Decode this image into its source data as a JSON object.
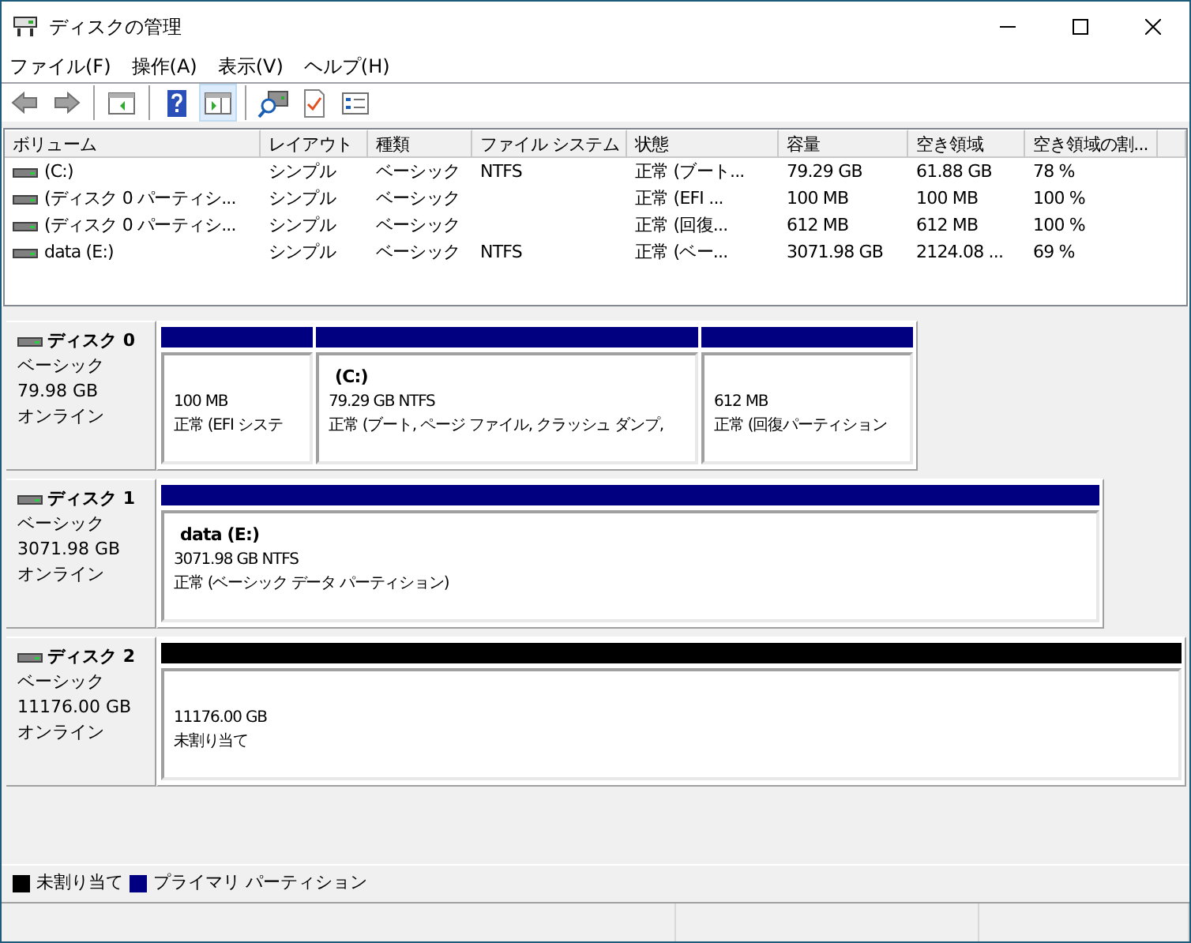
{
  "window": {
    "title": "ディスクの管理"
  },
  "menu": [
    "ファイル(F)",
    "操作(A)",
    "表示(V)",
    "ヘルプ(H)"
  ],
  "toolbar": [
    {
      "kind": "back",
      "selected": false
    },
    {
      "kind": "forward",
      "selected": false
    },
    {
      "kind": "sep"
    },
    {
      "kind": "tree",
      "selected": false
    },
    {
      "kind": "sep"
    },
    {
      "kind": "help",
      "selected": false
    },
    {
      "kind": "pane",
      "selected": true
    },
    {
      "kind": "sep"
    },
    {
      "kind": "connect",
      "selected": false
    },
    {
      "kind": "props",
      "selected": false
    },
    {
      "kind": "list",
      "selected": false
    }
  ],
  "volume_table": {
    "columns": [
      "ボリューム",
      "レイアウト",
      "種類",
      "ファイル システム",
      "状態",
      "容量",
      "空き領域",
      "空き領域の割..."
    ],
    "rows": [
      [
        "(C:)",
        "シンプル",
        "ベーシック",
        "NTFS",
        "正常 (ブート...",
        "79.29 GB",
        "61.88 GB",
        "78 %"
      ],
      [
        "(ディスク 0 パーティシ...",
        "シンプル",
        "ベーシック",
        "",
        "正常 (EFI ...",
        "100 MB",
        "100 MB",
        "100 %"
      ],
      [
        "(ディスク 0 パーティシ...",
        "シンプル",
        "ベーシック",
        "",
        "正常 (回復...",
        "612 MB",
        "612 MB",
        "100 %"
      ],
      [
        "data (E:)",
        "シンプル",
        "ベーシック",
        "NTFS",
        "正常 (ベー...",
        "3071.98 GB",
        "2124.08 ...",
        "69 %"
      ]
    ]
  },
  "disks": [
    {
      "name": "ディスク 0",
      "type": "ベーシック",
      "size": "79.98 GB",
      "status": "オンライン",
      "partitions": [
        {
          "color": "#000080",
          "size": "100 MB",
          "status": "正常 (EFI システ"
        },
        {
          "color": "#000080",
          "label": "(C:)",
          "size": "79.29 GB NTFS",
          "status": "正常 (ブート, ページ ファイル, クラッシュ ダンプ,"
        },
        {
          "color": "#000080",
          "size": "612 MB",
          "status": "正常 (回復パーティション"
        }
      ]
    },
    {
      "name": "ディスク 1",
      "type": "ベーシック",
      "size": "3071.98 GB",
      "status": "オンライン",
      "partitions": [
        {
          "color": "#000080",
          "label": "data  (E:)",
          "size": "3071.98 GB NTFS",
          "status": "正常 (ベーシック データ パーティション)"
        }
      ]
    },
    {
      "name": "ディスク 2",
      "type": "ベーシック",
      "size": "11176.00 GB",
      "status": "オンライン",
      "partitions": [
        {
          "color": "#000000",
          "size": "11176.00 GB",
          "status": "未割り当て"
        }
      ]
    }
  ],
  "legend": [
    {
      "color": "#000000",
      "label": "未割り当て"
    },
    {
      "color": "#000080",
      "label": "プライマリ パーティション"
    }
  ]
}
